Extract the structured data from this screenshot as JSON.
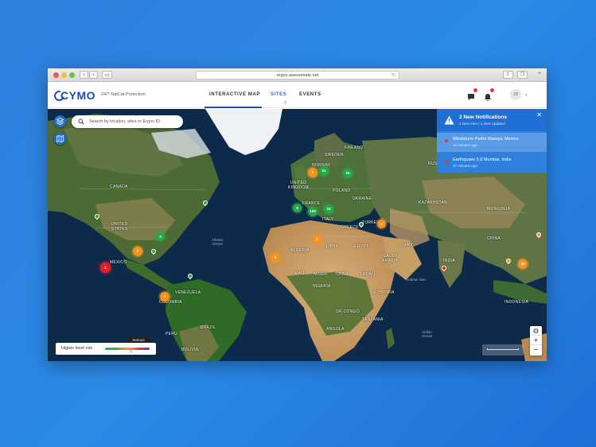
{
  "browser": {
    "url": "ergos.awesomate.net"
  },
  "header": {
    "logo": "CYMO",
    "tagline": "24/7 NatCat Protection",
    "nav": [
      {
        "label": "INTERACTIVE MAP"
      },
      {
        "label": "SITES"
      },
      {
        "label": "EVENTS"
      }
    ],
    "avatar_initials": "JD"
  },
  "search": {
    "placeholder": "Search by location, sites or Ergos ID"
  },
  "notifications": {
    "title": "2 New Notifications",
    "subtitle": "1 New Alert / 1 Alert Updated",
    "items": [
      {
        "title": "Windstorm Pedro Maoqui, Mexico",
        "time": "12 minutes ago"
      },
      {
        "title": "Earthquake 5.8 Mumbai, India",
        "time": "37 minutes ago"
      }
    ]
  },
  "legend": {
    "label": "Higher level risk",
    "tooltip": "Serious",
    "colors": [
      "#2bb44a",
      "#f7941d",
      "#e53935",
      "#7b2fb3"
    ]
  },
  "map": {
    "labels": {
      "canada": "CANADA",
      "us": "UNITED\nSTATES",
      "mexico": "MEXICO",
      "venezuela": "VENEZUELA",
      "colombia": "COLOMBIA",
      "brazil": "BRAZIL",
      "bolivia": "BOLIVIA",
      "peru": "PERU",
      "norway": "NORWAY",
      "sweden": "SWEDEN",
      "finland": "FINLAND",
      "uk": "UNITED\nKINGDOM",
      "france": "FRANCE",
      "poland": "POLAND",
      "ukraine": "UKRAINE",
      "italy": "ITALY",
      "greece": "GREECE",
      "turkey": "TURKEY",
      "russia": "RUSSIA",
      "kazakhstan": "KAZAKHSTAN",
      "mongolia": "MONGOLIA",
      "china": "CHINA",
      "india": "INDIA",
      "iran": "IRAN",
      "saudi": "SAUDI\nARABIA",
      "algeria": "ALGERIA",
      "libya": "LIBYA",
      "egypt": "EGYPT",
      "mali": "MALI",
      "niger": "NIGER",
      "chad": "CHAD",
      "sudan": "SUDAN",
      "nigeria": "NIGERIA",
      "ethiopia": "ETHIOPIA",
      "drc": "DR CONGO",
      "angola": "ANGOLA",
      "tanzania": "TANZANIA",
      "indonesia": "INDONESIA",
      "atlantic": "Atlantic\nOcean",
      "arabian": "Arabian Sea",
      "indian": "Indian\nOcean"
    },
    "clusters": [
      {
        "id": "mexico",
        "count": "1",
        "risk": "red"
      },
      {
        "id": "gulf",
        "count": "2",
        "risk": "orange"
      },
      {
        "id": "us-east",
        "count": "3",
        "risk": "green"
      },
      {
        "id": "colombia",
        "count": "3",
        "risk": "orange"
      },
      {
        "id": "west-africa",
        "count": "4",
        "risk": "orange"
      },
      {
        "id": "algeria",
        "count": "2",
        "risk": "orange"
      },
      {
        "id": "spain",
        "count": "9",
        "risk": "green"
      },
      {
        "id": "france",
        "count": "106",
        "risk": "green"
      },
      {
        "id": "germany",
        "count": "15",
        "risk": "green"
      },
      {
        "id": "uk",
        "count": "2",
        "risk": "orange"
      },
      {
        "id": "denmark",
        "count": "24",
        "risk": "green"
      },
      {
        "id": "baltic",
        "count": "15",
        "risk": "green"
      },
      {
        "id": "turkey",
        "count": "4",
        "risk": "orange"
      },
      {
        "id": "china",
        "count": "34",
        "risk": "orange"
      }
    ]
  }
}
